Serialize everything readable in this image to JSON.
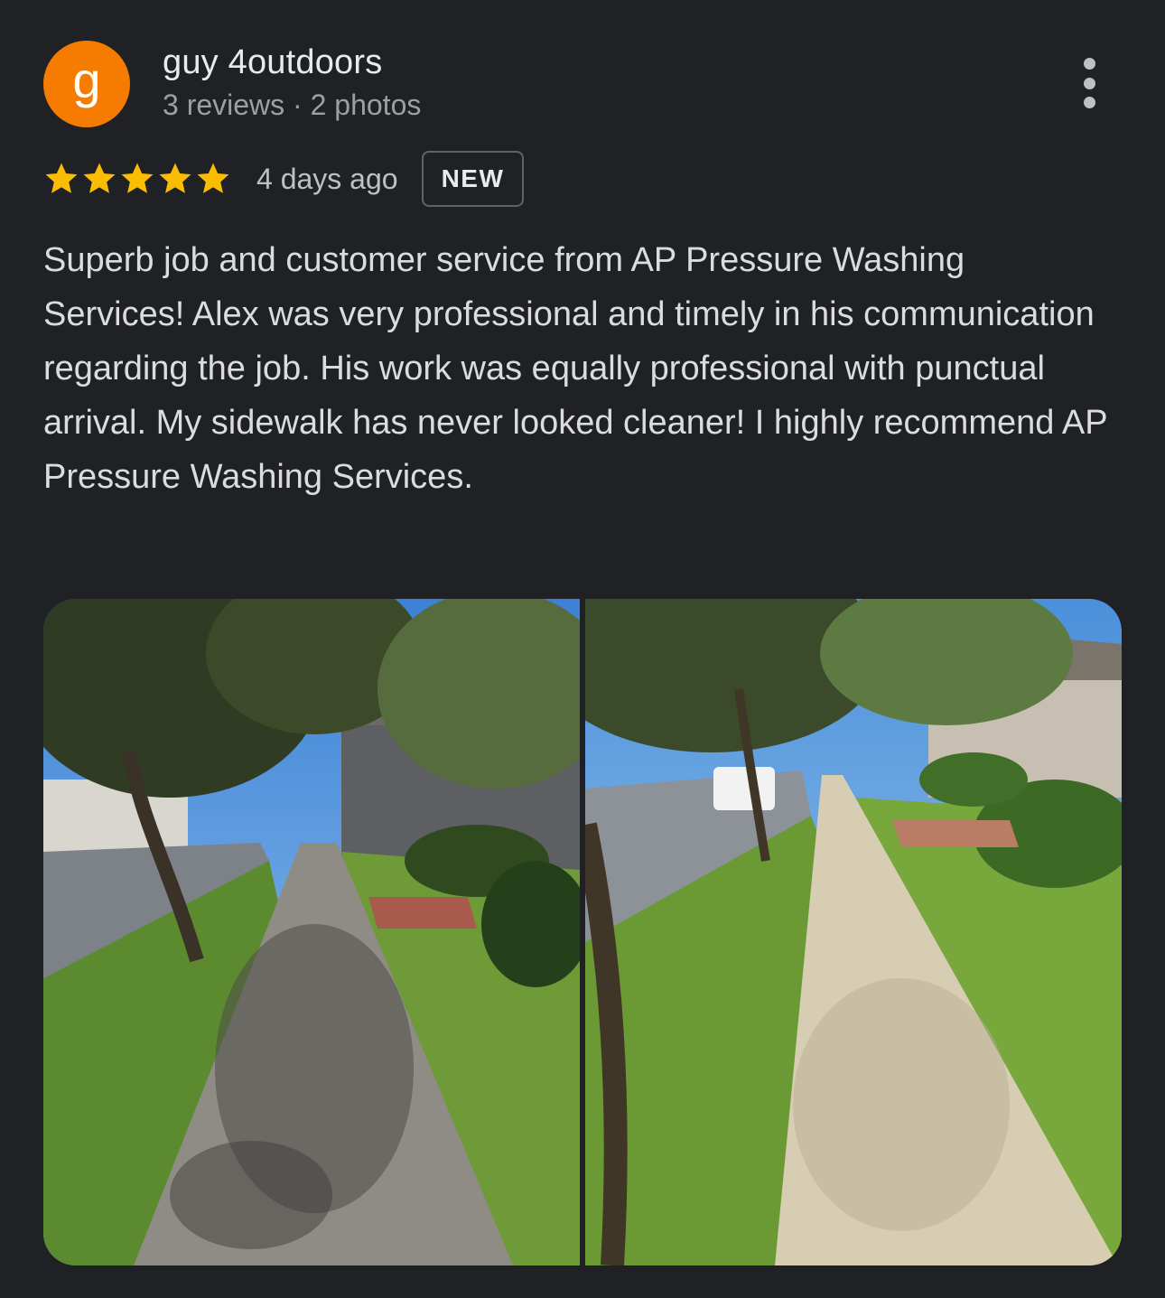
{
  "reviewer": {
    "avatar_letter": "g",
    "avatar_color": "#f57c00",
    "name": "guy 4outdoors",
    "meta": "3 reviews · 2 photos"
  },
  "rating": {
    "stars": 5,
    "max_stars": 5,
    "star_color": "#fbbc04",
    "date": "4 days ago",
    "badge": "NEW"
  },
  "review": {
    "text": "Superb job and customer service from AP Pressure Washing Services! Alex was very professional and timely in his communication regarding the job. His work was equally professional with punctual arrival. My sidewalk has never looked cleaner! I highly recommend AP Pressure Washing Services."
  },
  "photos": [
    {
      "name": "review-photo-before"
    },
    {
      "name": "review-photo-after"
    }
  ],
  "icons": {
    "more": "more-vert-icon",
    "star": "star-icon"
  }
}
